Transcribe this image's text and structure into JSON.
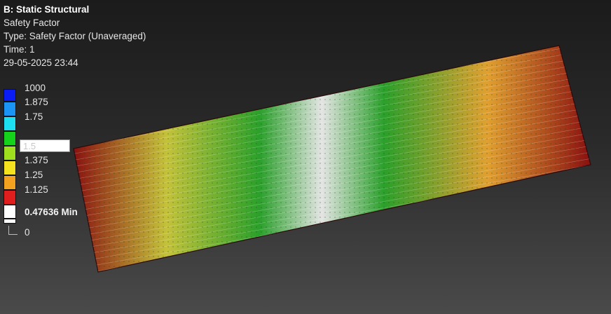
{
  "header": {
    "title": "B: Static Structural",
    "result_name": "Safety Factor",
    "type_line": "Type: Safety Factor (Unaveraged)",
    "time_line": "Time: 1",
    "date_line": "29-05-2025 23:44"
  },
  "legend": {
    "labels": [
      "1000",
      "1.875",
      "1.75",
      "1.375",
      "1.25",
      "1.125",
      "0.47636 Min",
      "0"
    ],
    "editable_value": "1.5",
    "colors": [
      "#0b1df5",
      "#1a94f5",
      "#1ce0f0",
      "#15d21b",
      "#9ee01e",
      "#f5e21e",
      "#f2a21e",
      "#e01e1e",
      "#ffffff"
    ]
  },
  "model": {
    "gradient_colors": [
      "#8a1010",
      "#c4c23a",
      "#2aa02a",
      "#e4e4e4",
      "#2aa02a",
      "#e0a030",
      "#8a1010"
    ]
  }
}
